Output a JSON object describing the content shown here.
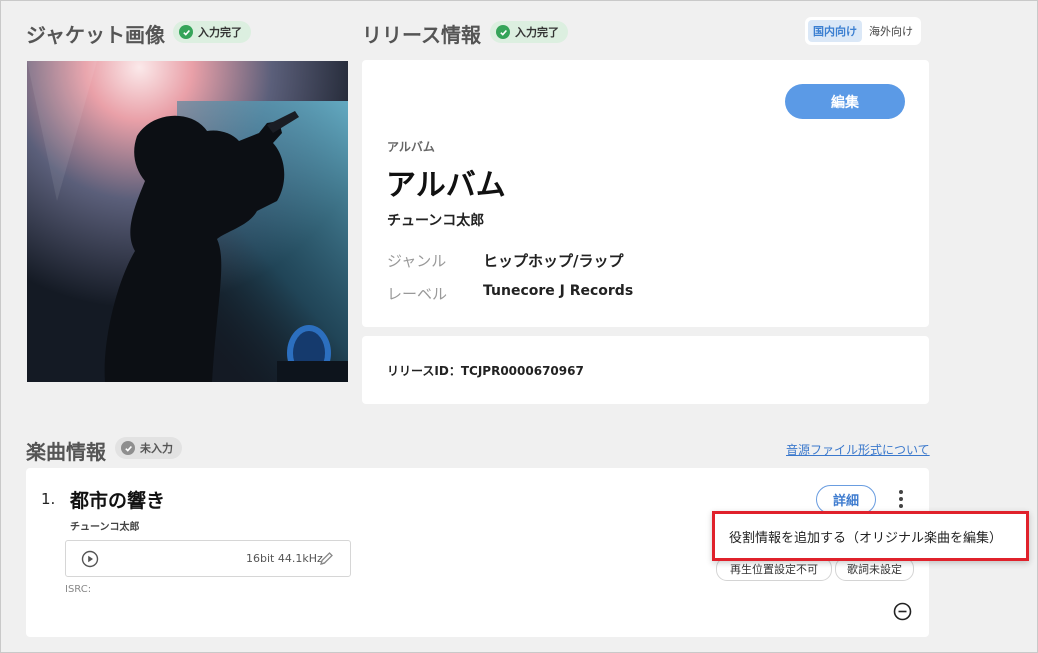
{
  "jacket": {
    "title": "ジャケット画像",
    "badge": "入力完了"
  },
  "release": {
    "title": "リリース情報",
    "badge": "入力完了",
    "region_toggle": [
      "国内向け",
      "海外向け"
    ],
    "edit_label": "編集",
    "type_label": "アルバム",
    "album_title": "アルバム",
    "artist": "チューンコ太郎",
    "genre_key": "ジャンル",
    "genre_value": "ヒップホップ/ラップ",
    "label_key": "レーベル",
    "label_value": "Tunecore J Records",
    "release_id": "リリースID：TCJPR0000670967"
  },
  "tracks": {
    "title": "楽曲情報",
    "badge": "未入力",
    "format_link": "音源ファイル形式について",
    "items": [
      {
        "number": "1.",
        "title": "都市の響き",
        "artist": "チューンコ太郎",
        "audio_spec": "16bit 44.1kHz",
        "isrc": "ISRC: ",
        "detail_label": "詳細",
        "tags": [
          "再生位置設定不可",
          "歌詞未設定"
        ]
      }
    ]
  },
  "context_menu": {
    "item": "役割情報を追加する（オリジナル楽曲を編集）"
  },
  "colors": {
    "accent": "#5b9ae6",
    "done_badge": "#dcefe0",
    "highlight": "#e0212b"
  }
}
